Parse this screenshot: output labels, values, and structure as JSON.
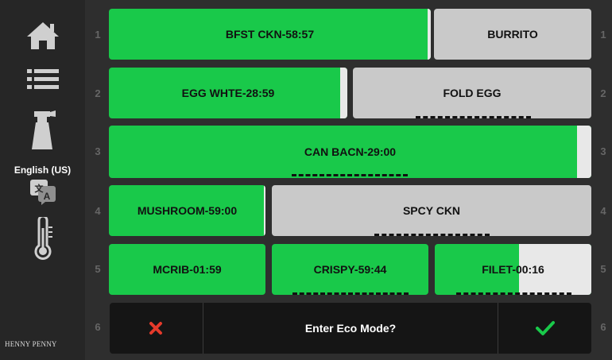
{
  "sidebar": {
    "home_icon": "home-icon",
    "list_icon": "list-icon",
    "clean_icon": "spray-bottle-icon",
    "language_label": "English (US)",
    "language_icon": "translate-icon",
    "temp_icon": "thermometer-icon",
    "brand": "HENNY PENNY"
  },
  "colors": {
    "active_green": "#19c94a",
    "idle_gray": "#c9c9c9",
    "cancel_red": "#e53a2b",
    "confirm_green": "#19c94a"
  },
  "rows": {
    "numbers_left": [
      "1",
      "2",
      "3",
      "4",
      "5",
      "6"
    ],
    "numbers_right": [
      "1",
      "2",
      "3",
      "4",
      "5",
      "6"
    ]
  },
  "cells": {
    "r1_a": {
      "label": "BFST CKN-58:57",
      "state": "active",
      "progress": 0.99
    },
    "r1_b": {
      "label": "BURRITO",
      "state": "idle"
    },
    "r2_a": {
      "label": "EGG WHTE-28:59",
      "state": "active",
      "progress": 0.97
    },
    "r2_b": {
      "label": "FOLD EGG",
      "state": "idle"
    },
    "r3_a": {
      "label": "CAN BACN-29:00",
      "state": "active",
      "progress": 0.97
    },
    "r4_a": {
      "label": "MUSHROOM-59:00",
      "state": "active",
      "progress": 0.99
    },
    "r4_b": {
      "label": "SPCY CKN",
      "state": "idle"
    },
    "r5_a": {
      "label": "MCRIB-01:59",
      "state": "active",
      "progress": 1.0
    },
    "r5_b": {
      "label": "CRISPY-59:44",
      "state": "active",
      "progress": 1.0
    },
    "r5_c": {
      "label": "FILET-00:16",
      "state": "active",
      "progress": 0.54
    }
  },
  "eco": {
    "prompt": "Enter Eco Mode?",
    "cancel_icon": "close-icon",
    "confirm_icon": "checkmark-icon"
  }
}
